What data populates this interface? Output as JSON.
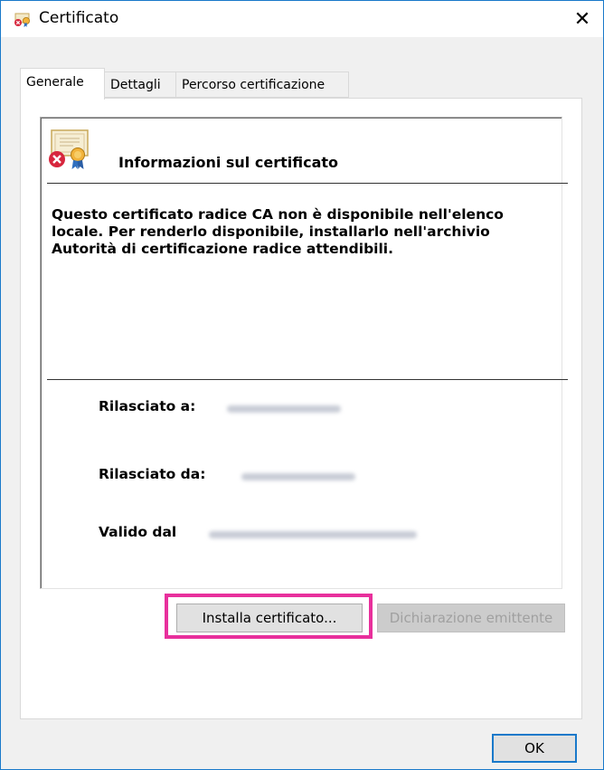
{
  "window": {
    "title": "Certificato",
    "close_symbol": "✕"
  },
  "tabs": [
    {
      "label": "Generale",
      "active": true
    },
    {
      "label": "Dettagli",
      "active": false
    },
    {
      "label": "Percorso certificazione",
      "active": false
    }
  ],
  "info": {
    "title": "Informazioni sul certificato",
    "message": "Questo certificato radice CA non è disponibile nell'elenco locale. Per renderlo disponibile, installarlo nell'archivio Autorità di certificazione radice attendibili.",
    "issued_to_label": "Rilasciato a:",
    "issued_by_label": "Rilasciato da:",
    "valid_label": "Valido dal"
  },
  "buttons": {
    "install_label": "Installa certificato...",
    "issuer_statement_label": "Dichiarazione emittente",
    "ok_label": "OK"
  },
  "colors": {
    "accent": "#1979ca",
    "highlight": "#e8309c"
  },
  "icons": {
    "title_icon": "certificate-error-icon",
    "cert_icon": "certificate-error-icon"
  }
}
